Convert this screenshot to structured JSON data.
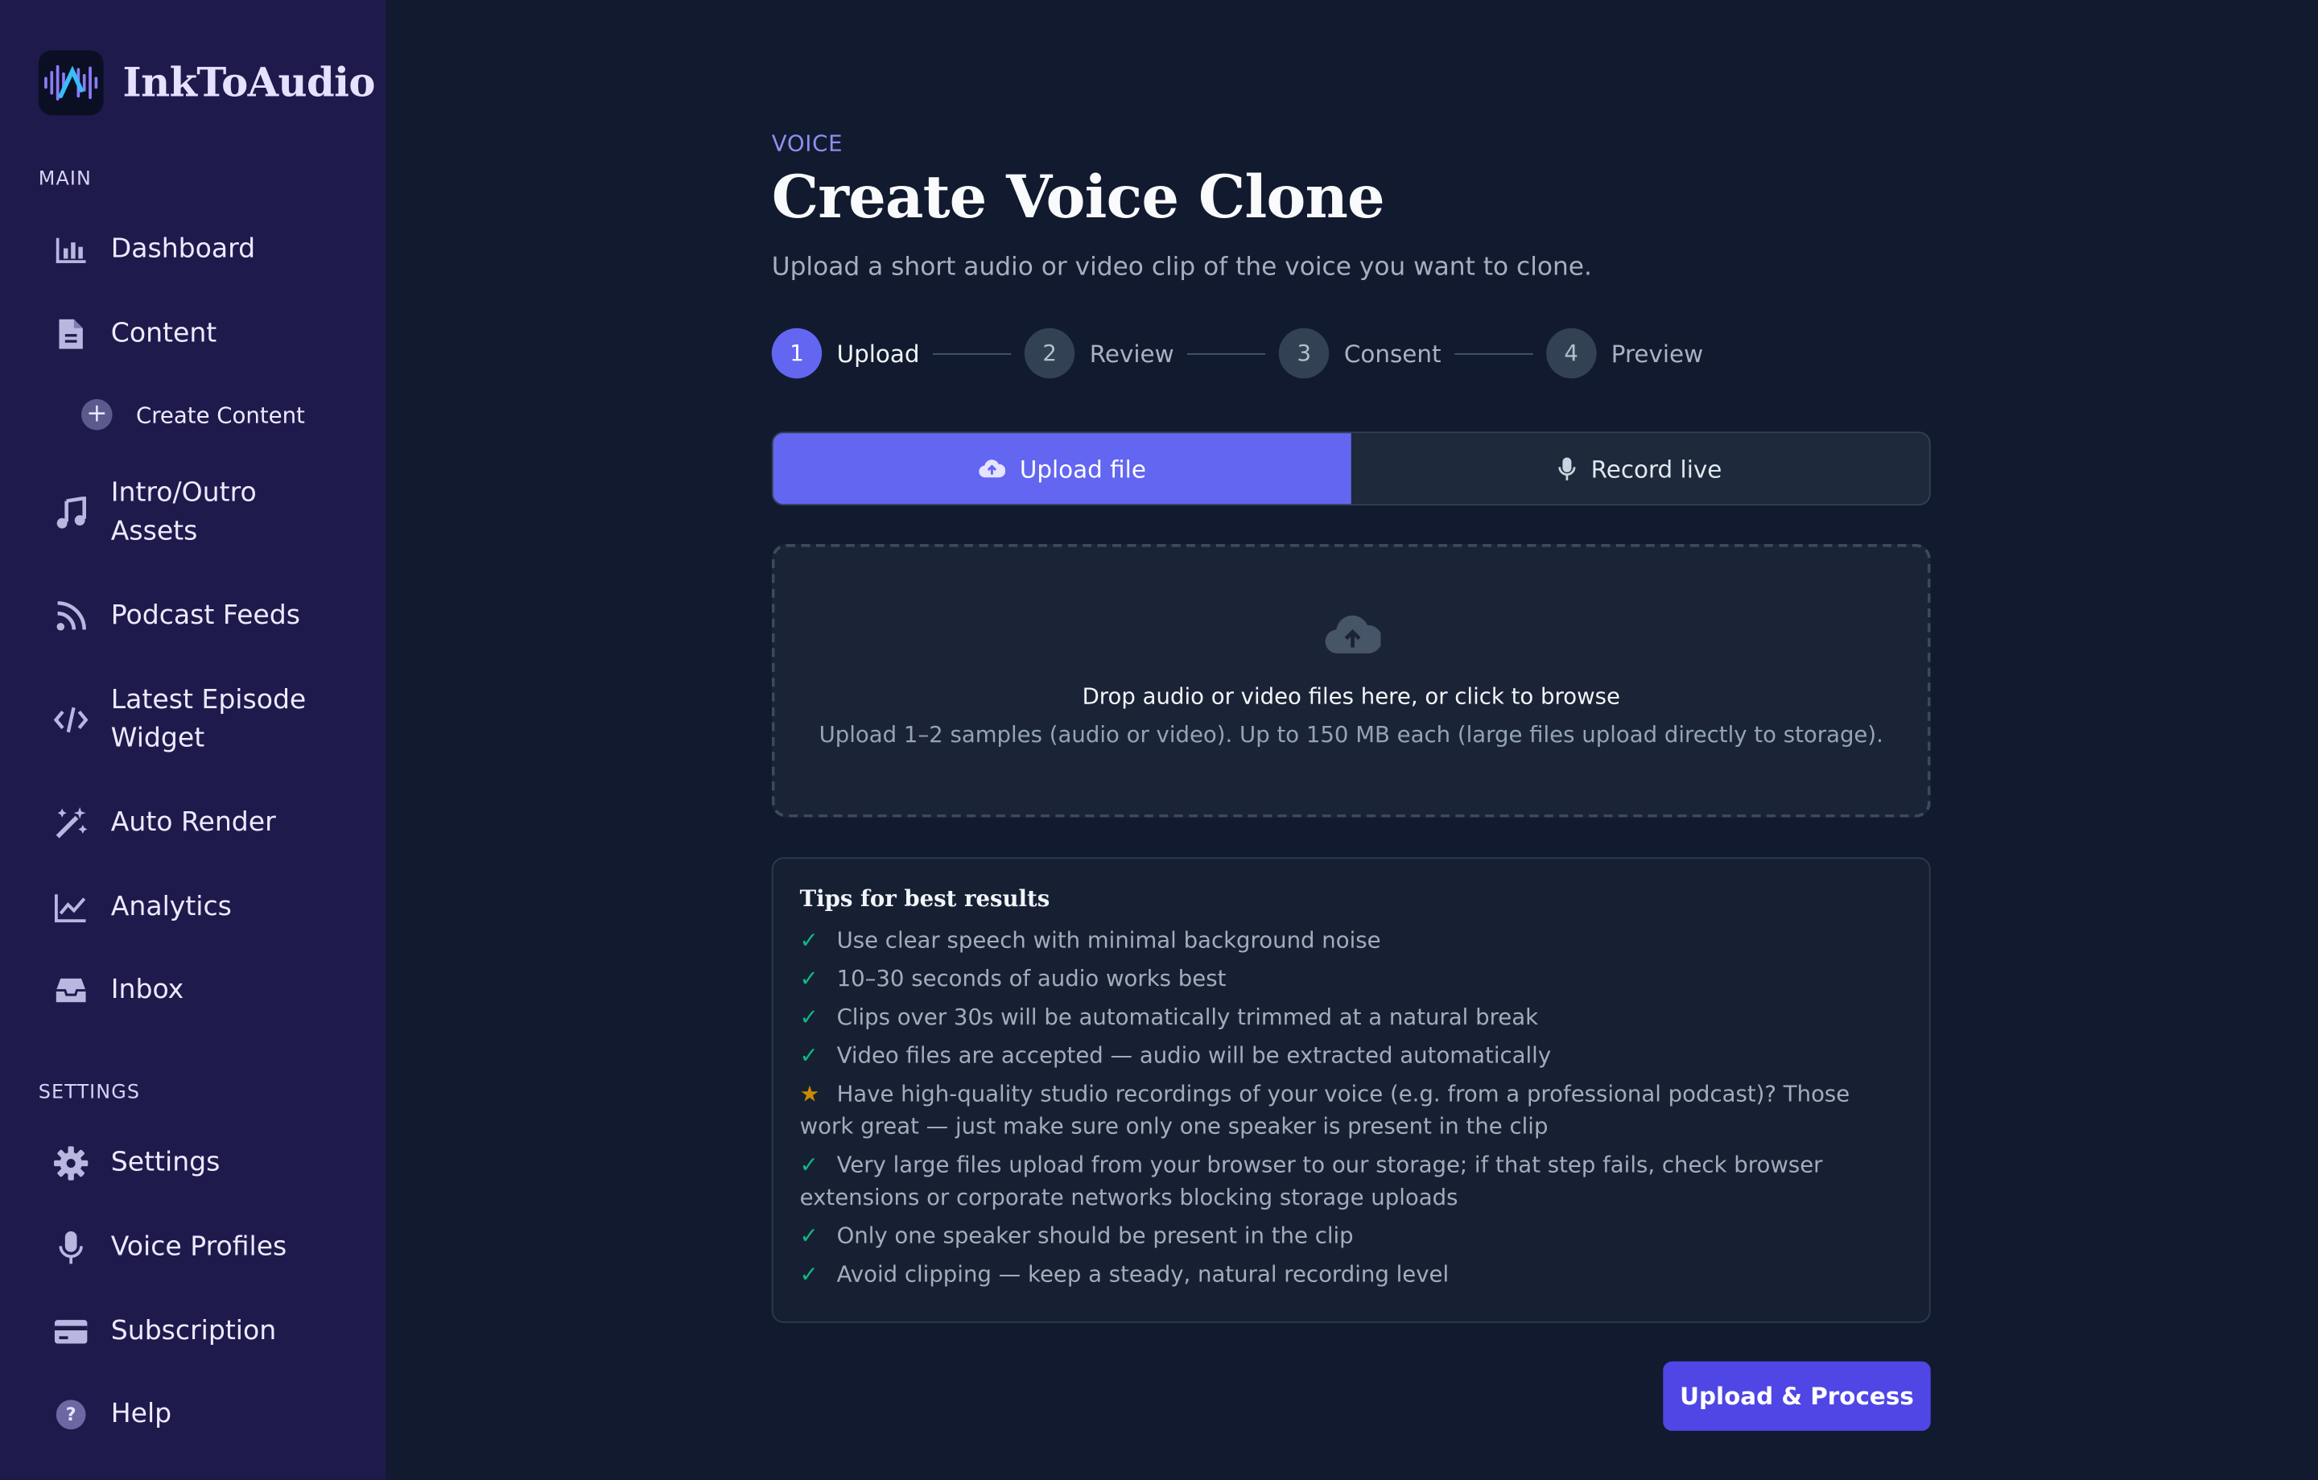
{
  "brand": {
    "name": "InkToAudio",
    "logo_icon": "waveform-logo"
  },
  "sidebar": {
    "main_label": "MAIN",
    "settings_label": "SETTINGS",
    "items": [
      {
        "label": "Dashboard",
        "icon": "bar-chart-icon"
      },
      {
        "label": "Content",
        "icon": "document-icon"
      },
      {
        "label": "Create Content",
        "icon": "plus-circle-icon"
      },
      {
        "label": "Intro/Outro Assets",
        "icon": "music-note-icon"
      },
      {
        "label": "Podcast Feeds",
        "icon": "rss-icon"
      },
      {
        "label": "Latest Episode Widget",
        "icon": "code-icon"
      },
      {
        "label": "Auto Render",
        "icon": "magic-wand-icon"
      },
      {
        "label": "Analytics",
        "icon": "line-chart-icon"
      },
      {
        "label": "Inbox",
        "icon": "inbox-icon"
      }
    ],
    "settings_items": [
      {
        "label": "Settings",
        "icon": "gear-icon"
      },
      {
        "label": "Voice Profiles",
        "icon": "microphone-icon"
      },
      {
        "label": "Subscription",
        "icon": "credit-card-icon"
      },
      {
        "label": "Help",
        "icon": "help-circle-icon"
      }
    ]
  },
  "header": {
    "kicker": "VOICE",
    "title": "Create Voice Clone",
    "subtitle": "Upload a short audio or video clip of the voice you want to clone."
  },
  "steps": [
    {
      "number": "1",
      "label": "Upload",
      "active": true
    },
    {
      "number": "2",
      "label": "Review",
      "active": false
    },
    {
      "number": "3",
      "label": "Consent",
      "active": false
    },
    {
      "number": "4",
      "label": "Preview",
      "active": false
    }
  ],
  "tabs": {
    "upload": {
      "label": "Upload file",
      "icon": "cloud-upload-icon",
      "active": true
    },
    "record": {
      "label": "Record live",
      "icon": "microphone-icon",
      "active": false
    }
  },
  "dropzone": {
    "icon": "cloud-upload-icon",
    "title": "Drop audio or video files here, or click to browse",
    "description": "Upload 1–2 samples (audio or video). Up to 150 MB each (large files upload directly to storage)."
  },
  "tips": {
    "title": "Tips for best results",
    "items": [
      {
        "icon": "check-icon",
        "text": "Use clear speech with minimal background noise"
      },
      {
        "icon": "check-icon",
        "text": "10–30 seconds of audio works best"
      },
      {
        "icon": "check-icon",
        "text": "Clips over 30s will be automatically trimmed at a natural break"
      },
      {
        "icon": "check-icon",
        "text": "Video files are accepted — audio will be extracted automatically"
      },
      {
        "icon": "star-icon",
        "text": "Have high-quality studio recordings of your voice (e.g. from a professional podcast)? Those work great — just make sure only one speaker is present in the clip"
      },
      {
        "icon": "check-icon",
        "text": "Very large files upload from your browser to our storage; if that step fails, check browser extensions or corporate networks blocking storage uploads"
      },
      {
        "icon": "check-icon",
        "text": "Only one speaker should be present in the clip"
      },
      {
        "icon": "check-icon",
        "text": "Avoid clipping — keep a steady, natural recording level"
      }
    ]
  },
  "actions": {
    "primary_label": "Upload & Process"
  },
  "colors": {
    "sidebar_bg": "#1f1a4c",
    "main_bg": "#121a2f",
    "accent": "#6366f1",
    "button": "#4f46e5",
    "check": "#10b981",
    "star": "#ca8a04"
  }
}
